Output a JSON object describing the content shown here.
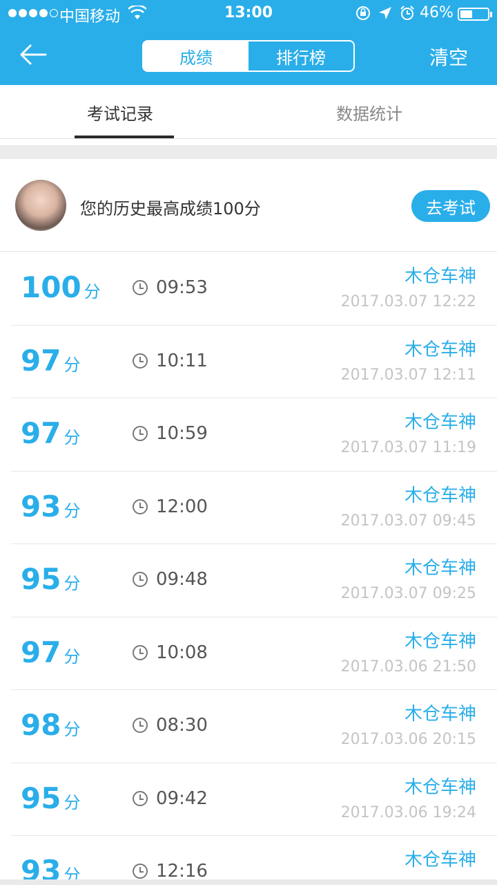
{
  "status_bar": {
    "carrier": "中国移动",
    "time": "13:00",
    "battery": "46%",
    "battery_level": 0.46
  },
  "nav": {
    "tabs": [
      {
        "label": "成绩",
        "active": true
      },
      {
        "label": "排行榜",
        "active": false
      }
    ],
    "clear_label": "清空"
  },
  "subtabs": [
    {
      "label": "考试记录",
      "active": true
    },
    {
      "label": "数据统计",
      "active": false
    }
  ],
  "summary": {
    "text": "您的历史最高成绩100分",
    "button_label": "去考试"
  },
  "records": [
    {
      "score": "100",
      "unit": "分",
      "duration": "09:53",
      "name": "木仓车神",
      "datetime": "2017.03.07 12:22"
    },
    {
      "score": "97",
      "unit": "分",
      "duration": "10:11",
      "name": "木仓车神",
      "datetime": "2017.03.07 12:11"
    },
    {
      "score": "97",
      "unit": "分",
      "duration": "10:59",
      "name": "木仓车神",
      "datetime": "2017.03.07 11:19"
    },
    {
      "score": "93",
      "unit": "分",
      "duration": "12:00",
      "name": "木仓车神",
      "datetime": "2017.03.07 09:45"
    },
    {
      "score": "95",
      "unit": "分",
      "duration": "09:48",
      "name": "木仓车神",
      "datetime": "2017.03.07 09:25"
    },
    {
      "score": "97",
      "unit": "分",
      "duration": "10:08",
      "name": "木仓车神",
      "datetime": "2017.03.06 21:50"
    },
    {
      "score": "98",
      "unit": "分",
      "duration": "08:30",
      "name": "木仓车神",
      "datetime": "2017.03.06 20:15"
    },
    {
      "score": "95",
      "unit": "分",
      "duration": "09:42",
      "name": "木仓车神",
      "datetime": "2017.03.06 19:24"
    },
    {
      "score": "93",
      "unit": "分",
      "duration": "12:16",
      "name": "木仓车神",
      "datetime": ""
    }
  ],
  "colors": {
    "accent": "#2aaee9",
    "muted": "#c4c4c4"
  }
}
